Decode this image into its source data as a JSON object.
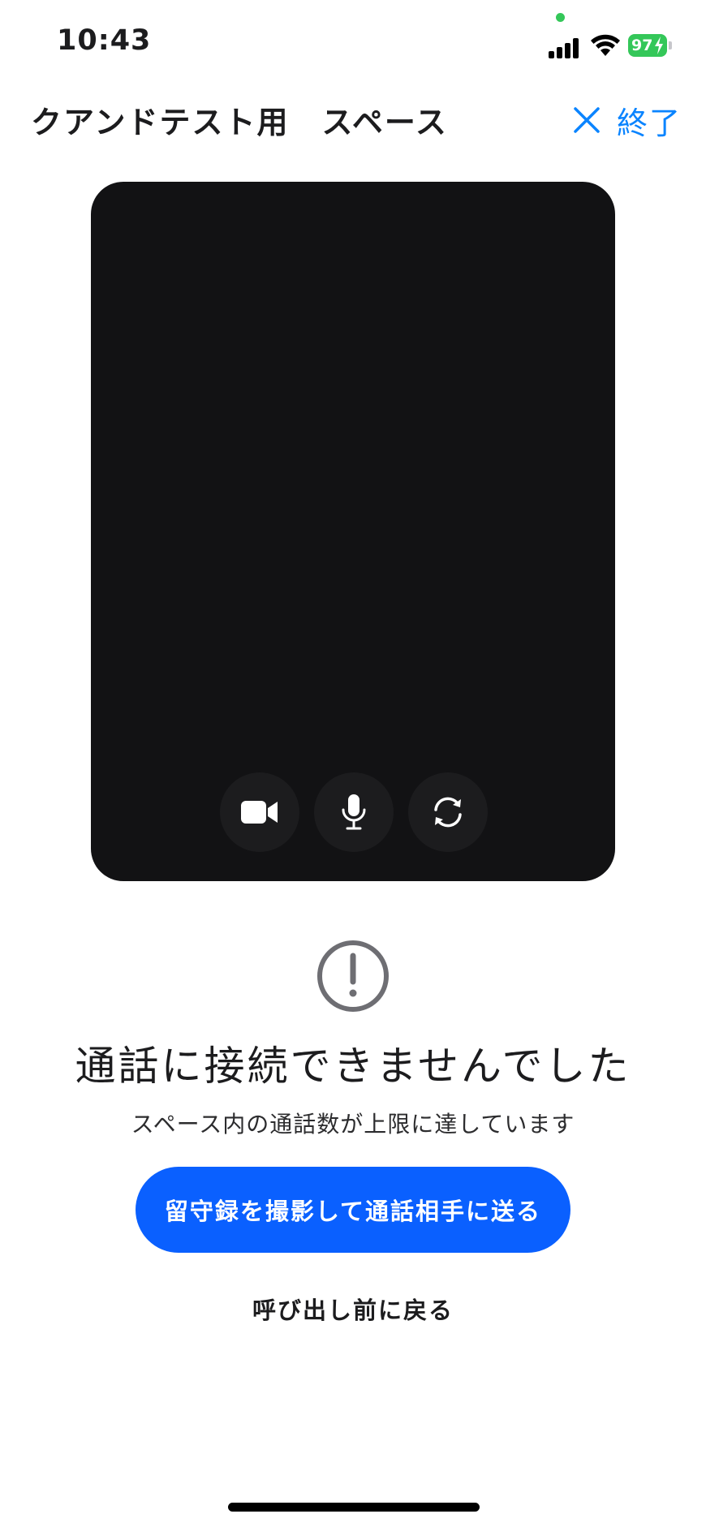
{
  "status_bar": {
    "time": "10:43",
    "battery_percent": "97",
    "charging": true,
    "signal_bars": 4,
    "wifi_icon": "wifi-icon",
    "mic_in_use_indicator": true
  },
  "header": {
    "title": "クアンドテスト用　スペース",
    "end_label": "終了",
    "end_icon": "close-icon"
  },
  "video_controls": [
    {
      "name": "camera-toggle",
      "icon": "video-camera-icon"
    },
    {
      "name": "mic-toggle",
      "icon": "microphone-icon"
    },
    {
      "name": "switch-camera",
      "icon": "camera-switch-icon"
    }
  ],
  "error": {
    "icon": "exclamation-circle-icon",
    "title": "通話に接続できませんでした",
    "message": "スペース内の通話数が上限に達しています"
  },
  "actions": {
    "primary_label": "留守録を撮影して通話相手に送る",
    "back_label": "呼び出し前に戻る"
  },
  "colors": {
    "accent": "#0a84ff",
    "primary_button": "#0a60ff",
    "video_bg": "#121214",
    "control_bg": "#1c1c1e",
    "battery": "#34c759"
  }
}
